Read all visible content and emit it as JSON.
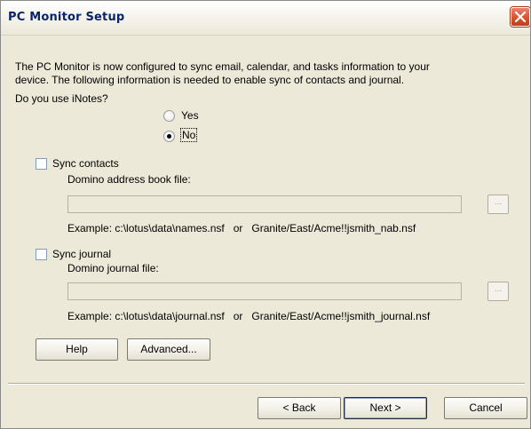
{
  "window": {
    "title": "PC Monitor Setup"
  },
  "intro": {
    "line1": "The PC Monitor is now configured to sync email, calendar, and tasks information to your",
    "line2": "device. The following information is needed to enable sync of contacts and journal."
  },
  "inotes": {
    "question": "Do you use iNotes?",
    "options": [
      {
        "label": "Yes",
        "selected": false
      },
      {
        "label": "No",
        "selected": true
      }
    ]
  },
  "contacts": {
    "checkbox_label": "Sync contacts",
    "checked": false,
    "field_label": "Domino address book file:",
    "value": "",
    "browse_label": "...",
    "example": "Example: c:\\lotus\\data\\names.nsf   or   Granite/East/Acme!!jsmith_nab.nsf"
  },
  "journal": {
    "checkbox_label": "Sync journal",
    "checked": false,
    "field_label": "Domino journal file:",
    "value": "",
    "browse_label": "...",
    "example": "Example: c:\\lotus\\data\\journal.nsf   or   Granite/East/Acme!!jsmith_journal.nsf"
  },
  "buttons": {
    "help": "Help",
    "advanced": "Advanced...",
    "back": "< Back",
    "next": "Next >",
    "cancel": "Cancel"
  }
}
